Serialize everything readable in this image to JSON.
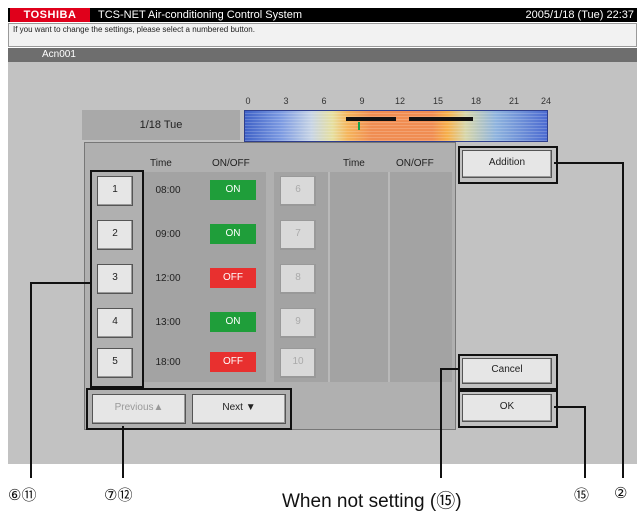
{
  "header": {
    "brand": "TOSHIBA",
    "title": "TCS-NET Air-conditioning Control System",
    "datetime": "2005/1/18 (Tue)  22:37"
  },
  "message": "If you want to change the settings, please select a numbered button.",
  "group": "Acn001",
  "timeline": {
    "date": "1/18 Tue",
    "ticks": [
      "0",
      "3",
      "6",
      "9",
      "12",
      "15",
      "18",
      "21",
      "24"
    ]
  },
  "schedule": {
    "col_time": "Time",
    "col_onoff": "ON/OFF",
    "rows": [
      {
        "num": "1",
        "time": "08:00",
        "state": "ON",
        "color": "#1f9e3a"
      },
      {
        "num": "2",
        "time": "09:00",
        "state": "ON",
        "color": "#1f9e3a"
      },
      {
        "num": "3",
        "time": "12:00",
        "state": "OFF",
        "color": "#e8302f"
      },
      {
        "num": "4",
        "time": "13:00",
        "state": "ON",
        "color": "#1f9e3a"
      },
      {
        "num": "5",
        "time": "18:00",
        "state": "OFF",
        "color": "#e8302f"
      }
    ],
    "rows_right": [
      {
        "num": "6"
      },
      {
        "num": "7"
      },
      {
        "num": "8"
      },
      {
        "num": "9"
      },
      {
        "num": "10"
      }
    ]
  },
  "buttons": {
    "addition": "Addition",
    "cancel": "Cancel",
    "ok": "OK",
    "previous": "Previous▲",
    "next": "Next ▼"
  },
  "callouts": {
    "numbers_btn": "⑥⑪",
    "paging": "⑦⑫",
    "note": "When not setting (⑮)",
    "ok": "⑮",
    "addition": "②"
  }
}
